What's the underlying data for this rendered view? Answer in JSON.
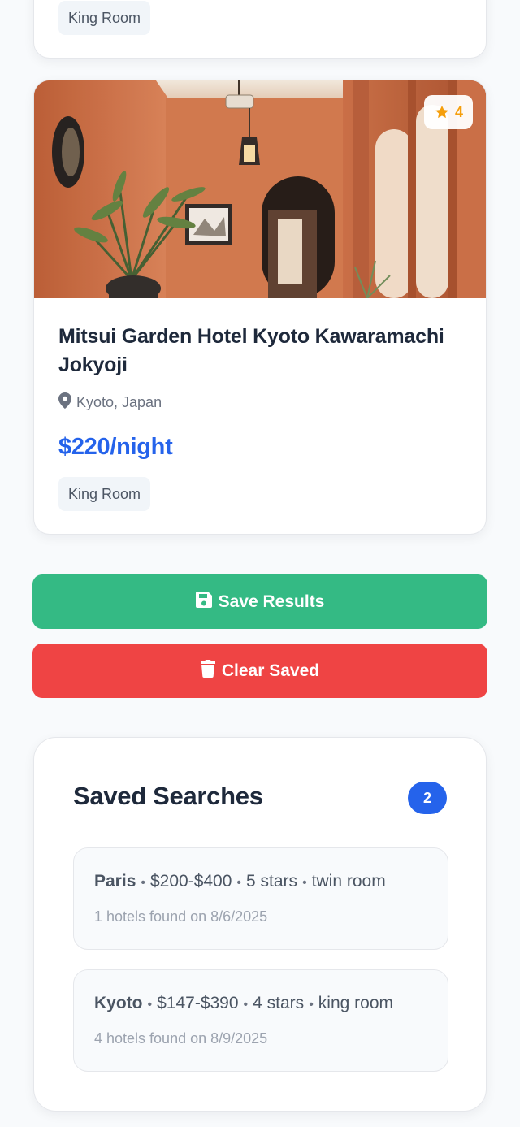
{
  "top_card": {
    "room_type": "King Room"
  },
  "hotel_card": {
    "rating": "4",
    "name": "Mitsui Garden Hotel Kyoto Kawaramachi Jokyoji",
    "location": "Kyoto, Japan",
    "price": "$220/night",
    "room_type": "King Room",
    "icons": {
      "rating": "star-icon",
      "location": "map-pin-icon"
    }
  },
  "actions": {
    "save_label": "Save Results",
    "clear_label": "Clear Saved",
    "colors": {
      "save": "#34ba84",
      "clear": "#ef4444"
    }
  },
  "saved_searches": {
    "title": "Saved Searches",
    "count": "2",
    "items": [
      {
        "city": "Paris",
        "price_range": "$200-$400",
        "stars": "5 stars",
        "room": "twin room",
        "summary": "1 hotels found on 8/6/2025"
      },
      {
        "city": "Kyoto",
        "price_range": "$147-$390",
        "stars": "4 stars",
        "room": "king room",
        "summary": "4 hotels found on 8/9/2025"
      }
    ]
  },
  "colors": {
    "accent": "#2563eb",
    "rating": "#f59e0b"
  }
}
